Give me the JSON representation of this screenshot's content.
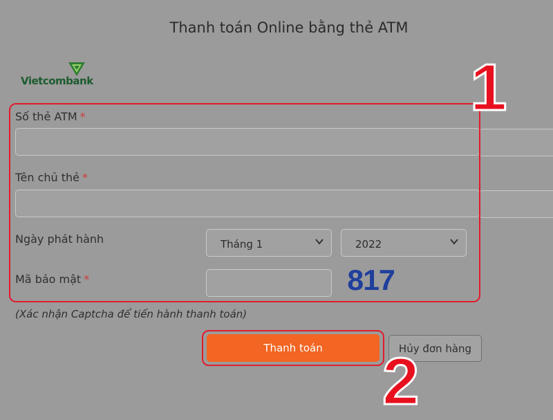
{
  "header": {
    "title": "Thanh toán Online bằng thẻ ATM"
  },
  "bank": {
    "logo_text": "Vietcombank",
    "icon": "vietcombank-logo-icon"
  },
  "form": {
    "card_number": {
      "label": "Số thẻ ATM",
      "required": "*",
      "value": ""
    },
    "card_holder": {
      "label": "Tên chủ thẻ",
      "required": "*",
      "value": ""
    },
    "issue_date": {
      "label": "Ngày phát hành",
      "month": "Tháng 1",
      "year": "2022"
    },
    "security_code": {
      "label": "Mã bảo mật",
      "required": "*",
      "value": ""
    },
    "captcha": "817",
    "note": "(Xác nhận Captcha để tiến hành thanh toán)"
  },
  "actions": {
    "pay": "Thanh toán",
    "cancel": "Hủy đơn hàng"
  },
  "annotations": {
    "step1": "1",
    "step2": "2",
    "highlight_color": "#e01b2d"
  }
}
